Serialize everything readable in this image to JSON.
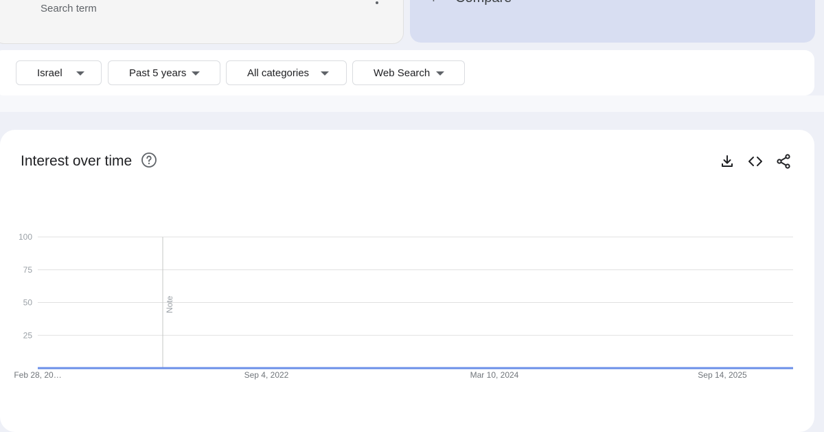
{
  "search": {
    "placeholder": "Search term"
  },
  "compare": {
    "plus": "+",
    "label": "Compare"
  },
  "filters": [
    {
      "label": "Israel"
    },
    {
      "label": "Past 5 years"
    },
    {
      "label": "All categories"
    },
    {
      "label": "Web Search"
    }
  ],
  "card": {
    "title": "Interest over time",
    "help_icon": "help-circle-icon",
    "actions": [
      "download-icon",
      "embed-code-icon",
      "share-icon"
    ]
  },
  "colors": {
    "line": "#6b8fe8",
    "grid": "#e0e0e0",
    "note_line": "#c4c7c5",
    "compare_bg": "#d8def2"
  },
  "chart_data": {
    "type": "line",
    "ylim": [
      0,
      100
    ],
    "yticks": [
      25,
      50,
      75,
      100
    ],
    "xtick_labels": [
      "Feb 28, 20…",
      "Sep 4, 2022",
      "Mar 10, 2024",
      "Sep 14, 2025"
    ],
    "note": "Note",
    "series": [
      {
        "values": [
          0,
          0,
          0,
          0,
          0,
          0,
          0,
          0,
          0,
          0,
          0,
          0,
          0,
          0,
          0,
          0,
          0,
          0,
          0,
          0,
          0,
          0,
          0,
          0,
          0,
          0,
          0,
          0,
          0,
          0,
          0,
          0,
          0,
          0,
          0,
          0,
          0,
          0,
          0,
          0,
          0,
          0,
          0,
          0,
          0,
          0,
          0,
          0,
          0,
          0,
          0,
          0,
          0,
          0,
          0,
          0,
          0,
          0,
          0,
          0,
          0,
          0,
          0,
          0,
          0,
          0,
          0,
          0,
          0,
          0,
          0,
          0,
          0,
          0,
          0,
          0,
          0,
          0,
          0,
          0,
          0,
          0,
          0,
          0,
          0,
          0,
          0,
          0,
          0,
          0,
          0,
          0,
          0,
          0,
          0,
          0,
          0,
          0,
          0,
          0,
          0,
          0,
          0,
          0,
          0,
          0,
          0,
          0,
          0,
          0,
          0,
          0,
          0,
          0,
          0,
          0,
          0,
          0,
          0,
          0,
          0,
          0,
          0,
          0,
          0,
          0,
          0,
          0,
          0,
          0,
          0,
          0,
          0,
          0,
          0,
          0,
          0,
          0,
          0,
          0,
          0,
          0,
          0,
          0,
          0,
          0,
          0,
          0,
          0,
          0,
          0,
          0,
          0,
          0,
          0,
          0,
          0,
          0,
          0,
          0,
          0,
          0,
          0,
          0,
          0,
          0,
          0,
          0,
          0,
          0,
          0,
          0,
          0,
          0,
          0,
          0,
          0,
          0,
          0,
          0,
          0,
          0,
          0,
          0,
          0,
          0,
          0,
          0,
          0,
          0,
          0,
          0,
          0,
          0,
          0,
          0,
          0,
          0,
          0,
          0,
          0,
          0,
          0,
          0,
          0,
          0,
          0,
          0,
          0,
          0,
          0,
          0,
          0,
          0,
          0,
          0,
          0,
          0,
          0,
          0,
          0,
          0,
          0,
          0,
          0,
          0,
          0,
          0,
          0,
          0,
          0,
          0,
          0,
          0,
          0,
          0,
          0,
          0,
          0,
          0,
          0,
          0,
          0,
          0,
          0,
          0,
          0,
          0,
          0,
          0,
          0,
          0,
          0,
          0,
          0,
          0,
          0,
          0,
          0,
          0,
          0,
          0,
          0,
          0,
          0,
          0,
          0,
          0,
          0,
          0
        ]
      }
    ]
  }
}
